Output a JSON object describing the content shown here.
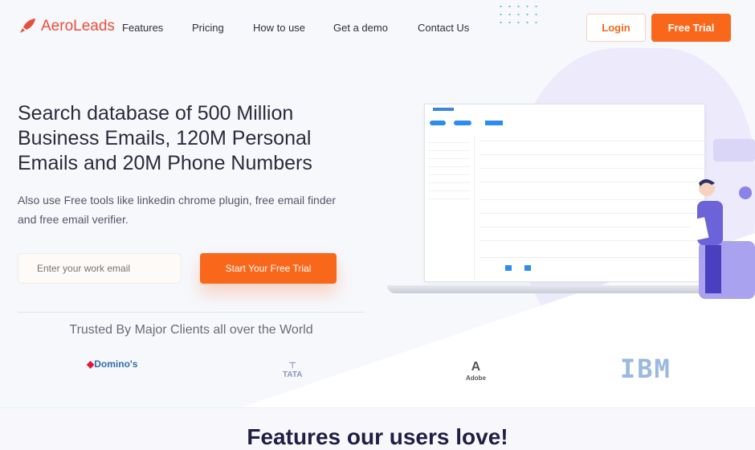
{
  "nav": {
    "brand": "AeroLeads",
    "links": [
      "Features",
      "Pricing",
      "How to use",
      "Get a demo",
      "Contact Us"
    ],
    "login": "Login",
    "free_trial": "Free Trial"
  },
  "hero": {
    "title": "Search database of 500 Million Business Emails, 120M Personal Emails and 20M Phone Numbers",
    "subtitle": "Also use Free tools like linkedin chrome plugin, free email finder and free email verifier.",
    "email_placeholder": "Enter your work email",
    "cta": "Start Your Free Trial"
  },
  "clients": {
    "heading": "Trusted By Major Clients all over the World",
    "logos": [
      "Domino's",
      "TATA",
      "Adobe",
      "IBM"
    ]
  },
  "features": {
    "title": "Features our users love!"
  },
  "colors": {
    "accent": "#f9671b",
    "brand": "#e8503a",
    "heading": "#1f1e44"
  }
}
